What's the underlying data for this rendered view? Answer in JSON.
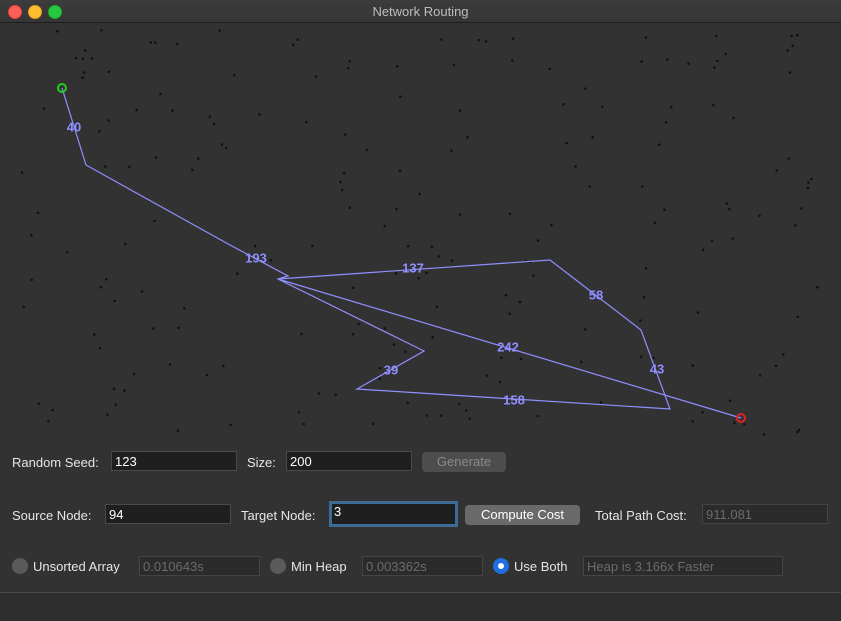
{
  "window": {
    "title": "Network Routing"
  },
  "graph": {
    "route_color": "#8f8fff",
    "source_color": "#22cc22",
    "target_color": "#dd2222",
    "edge_weights": [
      "40",
      "193",
      "137",
      "58",
      "43",
      "242",
      "39",
      "158"
    ]
  },
  "controls": {
    "random_seed_label": "Random Seed:",
    "random_seed_value": "123",
    "size_label": "Size:",
    "size_value": "200",
    "generate_label": "Generate",
    "source_node_label": "Source Node:",
    "source_node_value": "94",
    "target_node_label": "Target Node:",
    "target_node_value": "3",
    "compute_cost_label": "Compute Cost",
    "total_path_cost_label": "Total Path Cost:",
    "total_path_cost_value": "911.081",
    "unsorted_array_label": "Unsorted Array",
    "unsorted_array_time": "0.010643s",
    "min_heap_label": "Min Heap",
    "min_heap_time": "0.003362s",
    "use_both_label": "Use Both",
    "comparison_text": "Heap is 3.166x Faster"
  }
}
